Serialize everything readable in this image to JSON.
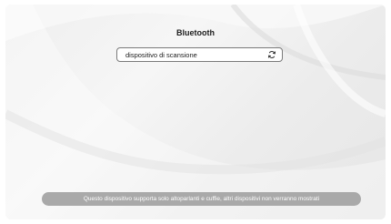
{
  "header": {
    "title": "Bluetooth"
  },
  "scan": {
    "label": "dispositivo di scansione",
    "icon": "refresh-icon"
  },
  "notice": {
    "text": "Questo dispositivo supporta solo altoparlanti e cuffie, altri dispositivi non verranno mostrati"
  },
  "colors": {
    "background": "#eeeeee",
    "notice_background": "#a9a9a9",
    "notice_text": "#ffffff",
    "field_border": "#7a7a7a"
  }
}
